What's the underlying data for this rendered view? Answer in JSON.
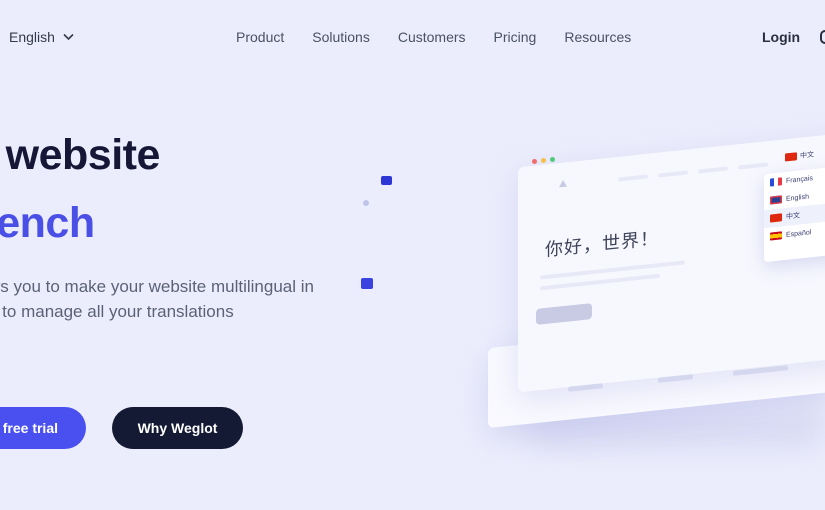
{
  "header": {
    "language": "English",
    "nav": [
      "Product",
      "Solutions",
      "Customers",
      "Pricing",
      "Resources"
    ],
    "login": "Login"
  },
  "hero": {
    "title_line1": "r website",
    "title_line2": "rench",
    "subtitle_lines": [
      "ws you to make your website multilingual in",
      "d to manage all your translations",
      "."
    ],
    "cta_trial": "r free trial",
    "cta_why": "Why Weglot"
  },
  "mockup": {
    "greeting": "你好，世界！",
    "current_language": "中文",
    "languages": [
      {
        "label": "Français",
        "flag": "fr"
      },
      {
        "label": "English",
        "flag": "gb"
      },
      {
        "label": "中文",
        "flag": "cn"
      },
      {
        "label": "Español",
        "flag": "es"
      }
    ],
    "traffic_colors": [
      "#f26b6b",
      "#f5c04a",
      "#52c87a"
    ]
  },
  "colors": {
    "background": "#ecedfc",
    "accent": "#4a50f0",
    "dark": "#141a33",
    "heading": "#161636"
  }
}
